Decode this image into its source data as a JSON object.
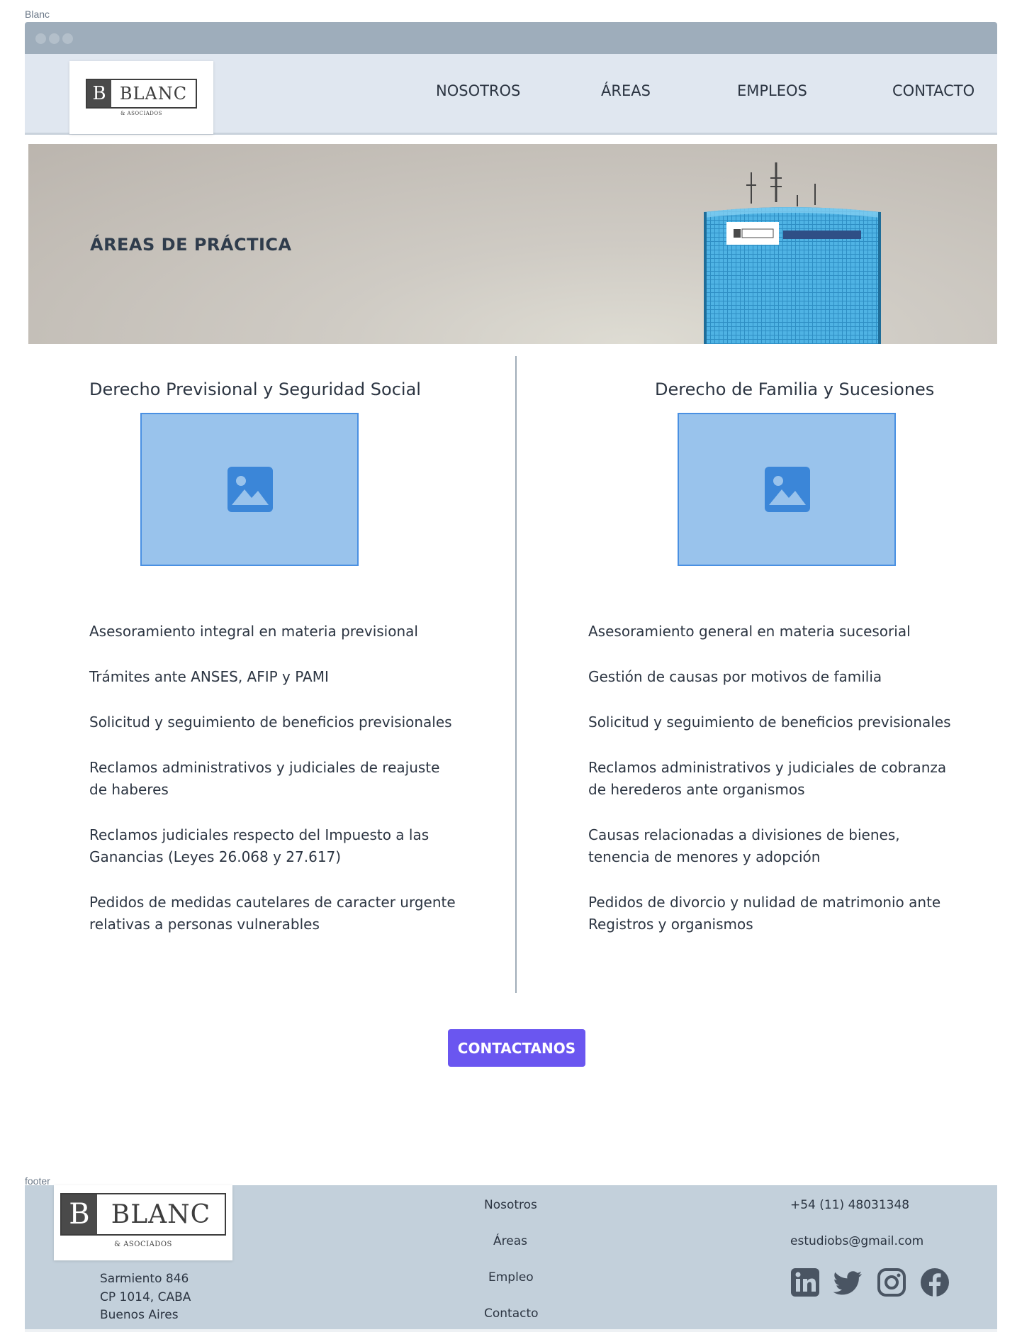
{
  "frame_label": "Blanc",
  "footer_label": "footer",
  "brand": {
    "logo_letter": "B",
    "logo_name": "BLANC",
    "logo_sub": "& ASOCIADOS"
  },
  "nav": [
    {
      "label": "NOSOTROS"
    },
    {
      "label": "ÁREAS"
    },
    {
      "label": "EMPLEOS"
    },
    {
      "label": "CONTACTO"
    }
  ],
  "hero": {
    "title": "ÁREAS DE PRÁCTICA"
  },
  "columns": [
    {
      "title": "Derecho Previsional y Seguridad Social",
      "items": [
        "Asesoramiento integral en materia previsional",
        "Trámites ante ANSES, AFIP y PAMI",
        "Solicitud y seguimiento de beneficios previsionales",
        "Reclamos administrativos y judiciales de reajuste de haberes",
        "Reclamos judiciales respecto del Impuesto a las Ganancias (Leyes 26.068 y 27.617)",
        "Pedidos de medidas cautelares de caracter urgente relativas a personas vulnerables"
      ]
    },
    {
      "title": "Derecho de Familia y Sucesiones",
      "items": [
        "Asesoramiento general en materia sucesorial",
        "Gestión de causas por motivos de familia",
        "Solicitud y seguimiento de beneficios previsionales",
        "Reclamos administrativos y judiciales de cobranza de herederos ante organismos",
        "Causas relacionadas a divisiones de bienes, tenencia de menores y adopción",
        "Pedidos de divorcio y nulidad de matrimonio ante Registros y organismos"
      ]
    }
  ],
  "cta": {
    "label": "CONTACTANOS"
  },
  "footer": {
    "address": [
      "Sarmiento 846",
      "CP 1014, CABA",
      "Buenos Aires"
    ],
    "links": [
      "Nosotros",
      "Áreas",
      "Empleo",
      "Contacto"
    ],
    "phone": "+54 (11) 48031348",
    "email": "estudiobs@gmail.com",
    "social_icons": [
      "linkedin-icon",
      "twitter-icon",
      "instagram-icon",
      "facebook-icon"
    ]
  },
  "colors": {
    "browser_bar": "#9eadbb",
    "header_bg": "#e0e7f0",
    "cta_bg": "#6a56f0",
    "footer_bg": "#c3d0db",
    "placeholder_bg": "#99c3ec",
    "placeholder_accent": "#4a90e2",
    "icon_dark": "#4a5563"
  }
}
